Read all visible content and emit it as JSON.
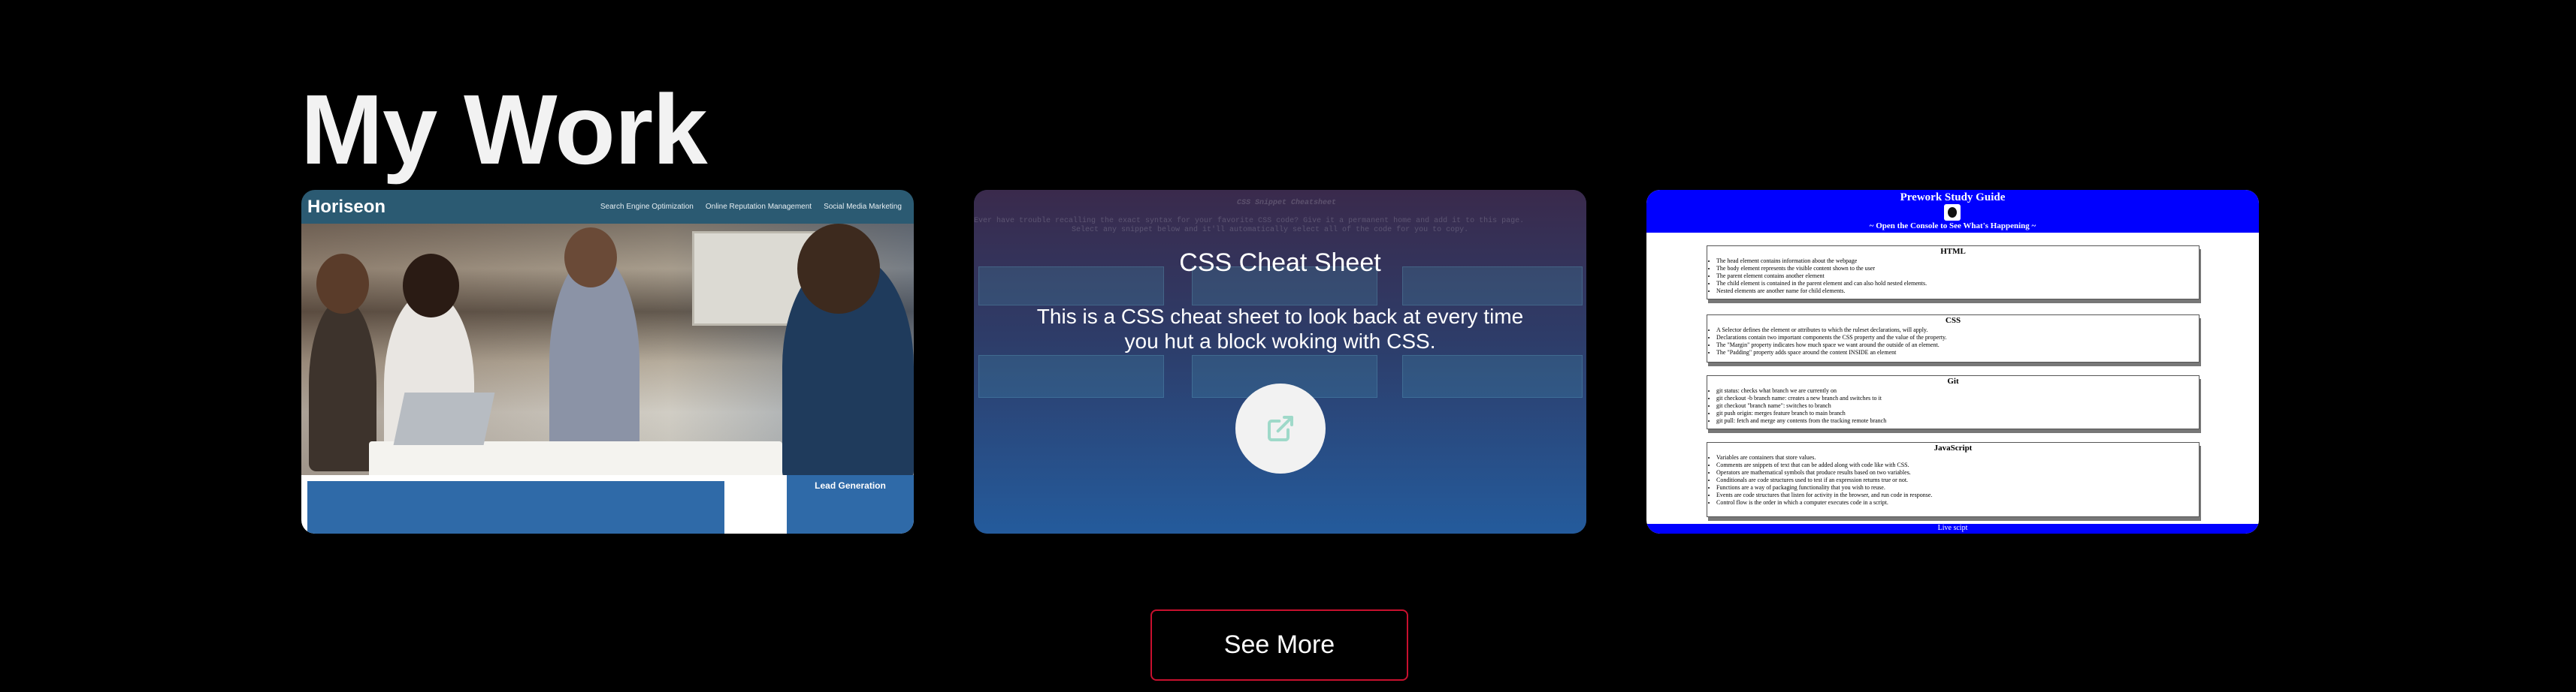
{
  "page": {
    "title": "My Work"
  },
  "projects": [
    {
      "name": "Horiseon",
      "nav_links": [
        "Search Engine Optimization",
        "Online Reputation Management",
        "Social Media Marketing"
      ],
      "cta": "Lead Generation"
    },
    {
      "name": "CSS Cheat Sheet",
      "description": "This is a CSS cheat sheet to look back at every time you hut a block woking with CSS.",
      "background_texts": [
        "CSS Snippet Cheatsheet",
        "Ever have trouble recalling the exact syntax for your favorite CSS code? Give it a permanent home and add it to this page.",
        "Select any snippet below and it'll automatically select all of the code for you to copy."
      ],
      "link_icon": "external-link-icon"
    },
    {
      "name": "Prework Study Guide",
      "subtitle": "~ Open the Console to See What's Happening ~",
      "sections": [
        {
          "title": "HTML",
          "items": [
            "The head element contains information about the webpage",
            "The body element represents the visible content shown to the user",
            "The parent element contains another element",
            "The child element is contained in the parent element and can also hold nested elements.",
            "Nested elements are another name for child elements."
          ]
        },
        {
          "title": "CSS",
          "items": [
            "A Selector defines the element or attributes to which the ruleset declarations, will apply.",
            "Declarations contain two important components the CSS property and the value of the property.",
            "The \"Margin\" property indicates how much space we want around the outside of an element.",
            "The \"Padding\" property adds space around the content INSIDE an element"
          ]
        },
        {
          "title": "Git",
          "items": [
            "git status: checks what branch we are currently on",
            "git checkout -b branch name: creates a new branch and switches to it",
            "git checkout \"branch name\": switches to branch",
            "git push origin: merges feature branch to main branch",
            "git pull: fetch and merge any contents from the tracking remote branch"
          ]
        },
        {
          "title": "JavaScript",
          "items": [
            "Variables are containers that store values.",
            "Comments are snippets of text that can be added along with code like with CSS.",
            "Operators are mathematical symbols that produce results based on two variables.",
            "Conditionals are code structures used to test if an expression returns true or not.",
            "Functions are a way of packaging functionality that you wish to reuse.",
            "Events are code structures that listen for activity in the browser, and run code in response.",
            "Control flow is the order in which a computer executes code in a script."
          ]
        }
      ],
      "footer": "Live scipt"
    }
  ],
  "actions": {
    "see_more": "See More"
  },
  "colors": {
    "background": "#000000",
    "accent_border": "#c8102e",
    "guide_blue": "#0000ff"
  }
}
